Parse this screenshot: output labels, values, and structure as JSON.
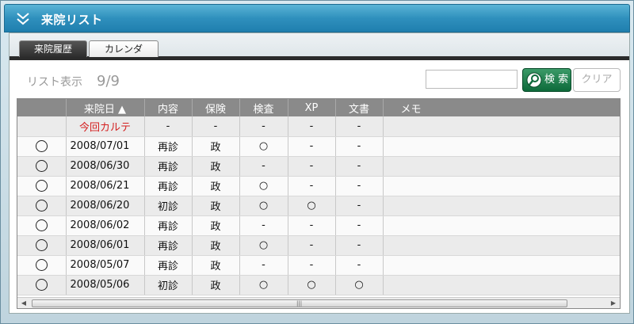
{
  "window": {
    "title": "来院リスト"
  },
  "tabs": [
    {
      "label": "来院履歴",
      "active": true
    },
    {
      "label": "カレンダ",
      "active": false
    }
  ],
  "list": {
    "label": "リスト表示",
    "count": "9/9"
  },
  "search": {
    "value": "",
    "button_label": "検 索",
    "clear_label": "クリア"
  },
  "columns": [
    "",
    "来院日 ▲",
    "内容",
    "保険",
    "検査",
    "XP",
    "文書",
    "メモ"
  ],
  "rows": [
    {
      "radio": false,
      "date": "今回カルテ",
      "content": "-",
      "insurance": "-",
      "exam": "-",
      "xp": "-",
      "doc": "-",
      "memo": ""
    },
    {
      "radio": true,
      "date": "2008/07/01",
      "content": "再診",
      "insurance": "政",
      "exam": "○",
      "xp": "-",
      "doc": "-",
      "memo": ""
    },
    {
      "radio": true,
      "date": "2008/06/30",
      "content": "再診",
      "insurance": "政",
      "exam": "-",
      "xp": "-",
      "doc": "-",
      "memo": ""
    },
    {
      "radio": true,
      "date": "2008/06/21",
      "content": "再診",
      "insurance": "政",
      "exam": "○",
      "xp": "-",
      "doc": "-",
      "memo": ""
    },
    {
      "radio": true,
      "date": "2008/06/20",
      "content": "初診",
      "insurance": "政",
      "exam": "○",
      "xp": "○",
      "doc": "-",
      "memo": ""
    },
    {
      "radio": true,
      "date": "2008/06/02",
      "content": "再診",
      "insurance": "政",
      "exam": "-",
      "xp": "-",
      "doc": "-",
      "memo": ""
    },
    {
      "radio": true,
      "date": "2008/06/01",
      "content": "再診",
      "insurance": "政",
      "exam": "○",
      "xp": "-",
      "doc": "-",
      "memo": ""
    },
    {
      "radio": true,
      "date": "2008/05/07",
      "content": "再診",
      "insurance": "政",
      "exam": "-",
      "xp": "-",
      "doc": "-",
      "memo": ""
    },
    {
      "radio": true,
      "date": "2008/05/06",
      "content": "初診",
      "insurance": "政",
      "exam": "○",
      "xp": "○",
      "doc": "○",
      "memo": ""
    }
  ],
  "colors": {
    "title_bar": "#2f90bd",
    "header": "#8a8a8a",
    "search_button": "#0d6a3a",
    "current_karte": "#d42020"
  },
  "icons": {
    "collapse": "double-chevron-down-icon",
    "search": "magnifier-icon"
  }
}
